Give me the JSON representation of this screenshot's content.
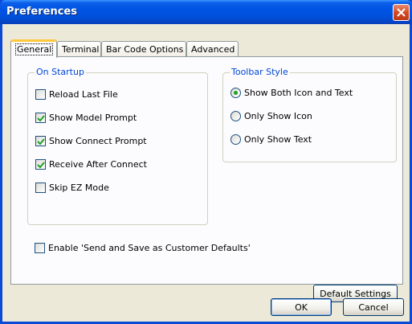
{
  "window": {
    "title": "Preferences"
  },
  "tabs": [
    {
      "label": "General",
      "active": true
    },
    {
      "label": "Terminal",
      "active": false
    },
    {
      "label": "Bar Code Options",
      "active": false
    },
    {
      "label": "Advanced",
      "active": false
    }
  ],
  "on_startup": {
    "title": "On Startup",
    "items": [
      {
        "label": "Reload Last File",
        "checked": false
      },
      {
        "label": "Show Model Prompt",
        "checked": true
      },
      {
        "label": "Show Connect Prompt",
        "checked": true
      },
      {
        "label": "Receive After Connect",
        "checked": true
      },
      {
        "label": "Skip EZ Mode",
        "checked": false
      }
    ]
  },
  "toolbar_style": {
    "title": "Toolbar Style",
    "options": [
      {
        "label": "Show Both Icon and Text",
        "selected": true
      },
      {
        "label": "Only Show Icon",
        "selected": false
      },
      {
        "label": "Only Show Text",
        "selected": false
      }
    ]
  },
  "enable_send_save": {
    "label": "Enable 'Send and Save as Customer Defaults'",
    "checked": false
  },
  "buttons": {
    "default_settings": "Default Settings",
    "ok": "OK",
    "cancel": "Cancel"
  },
  "colors": {
    "titlebar": "#0054e3",
    "group_title": "#0046d5",
    "check_mark": "#21a121",
    "active_tab_highlight": "#ffc83c"
  }
}
